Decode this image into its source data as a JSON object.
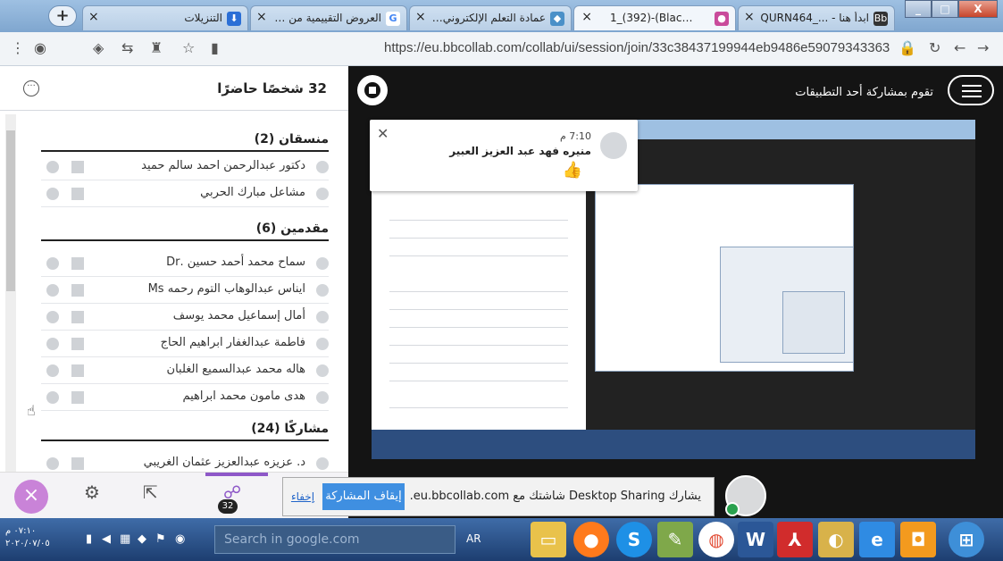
{
  "browser": {
    "tabs": [
      {
        "title": "التنزيلات",
        "icon": "download-icon",
        "active": false
      },
      {
        "title": "العروض التقييمية من Google",
        "icon": "google-icon",
        "active": false
      },
      {
        "title": "عمادة التعلم الإلكتروني والتعلم",
        "icon": "diamond-icon",
        "active": false
      },
      {
        "title": "1_(392)-(Black board",
        "icon": "record-icon",
        "active": true
      },
      {
        "title": "ابدأ هنا - ..._QURN464",
        "icon": "bb-icon",
        "active": false
      }
    ],
    "url": "https://eu.bbcollab.com/collab/ui/session/join/33c38437199944eb9486e59079343363"
  },
  "participants": {
    "title": "32 شخصًا حاضرًا",
    "sections": [
      {
        "label": "منسقان (2)",
        "rows": [
          "دكتور عبدالرحمن احمد سالم حميد",
          "مشاعل مبارك الحربي"
        ]
      },
      {
        "label": "مقدمين (6)",
        "rows": [
          "سماح محمد أحمد حسين .Dr",
          "ايناس عبدالوهاب التوم رحمه Ms",
          "أمال إسماعيل محمد يوسف",
          "فاطمة عبدالغفار ابراهيم الحاج",
          "هاله محمد عبدالسميع الغلبان",
          "هدى مامون محمد ابراهيم"
        ]
      },
      {
        "label": "مشاركًا (24)",
        "rows": [
          "د. عزيزه عبدالعزيز عثمان الغريبي"
        ]
      }
    ]
  },
  "collab_toolbar": {
    "badge": "32"
  },
  "stage": {
    "share_label": "تقوم بمشاركة أحد التطبيقات",
    "notification": {
      "time": "7:10 م",
      "name": "منيره فهد عبد العزيز العبير",
      "emoji": "👍"
    }
  },
  "share_bar": {
    "message": "يشارك Desktop Sharing شاشتك مع eu.bbcollab.com.",
    "stop_label": "إيقاف المشاركة",
    "hide_label": "إخفاء"
  },
  "taskbar": {
    "time": "٠٧:١٠ م",
    "date": "٢٠٢٠/٠٧/٠٥",
    "search_placeholder": "Search in google.com",
    "lang": "AR"
  }
}
